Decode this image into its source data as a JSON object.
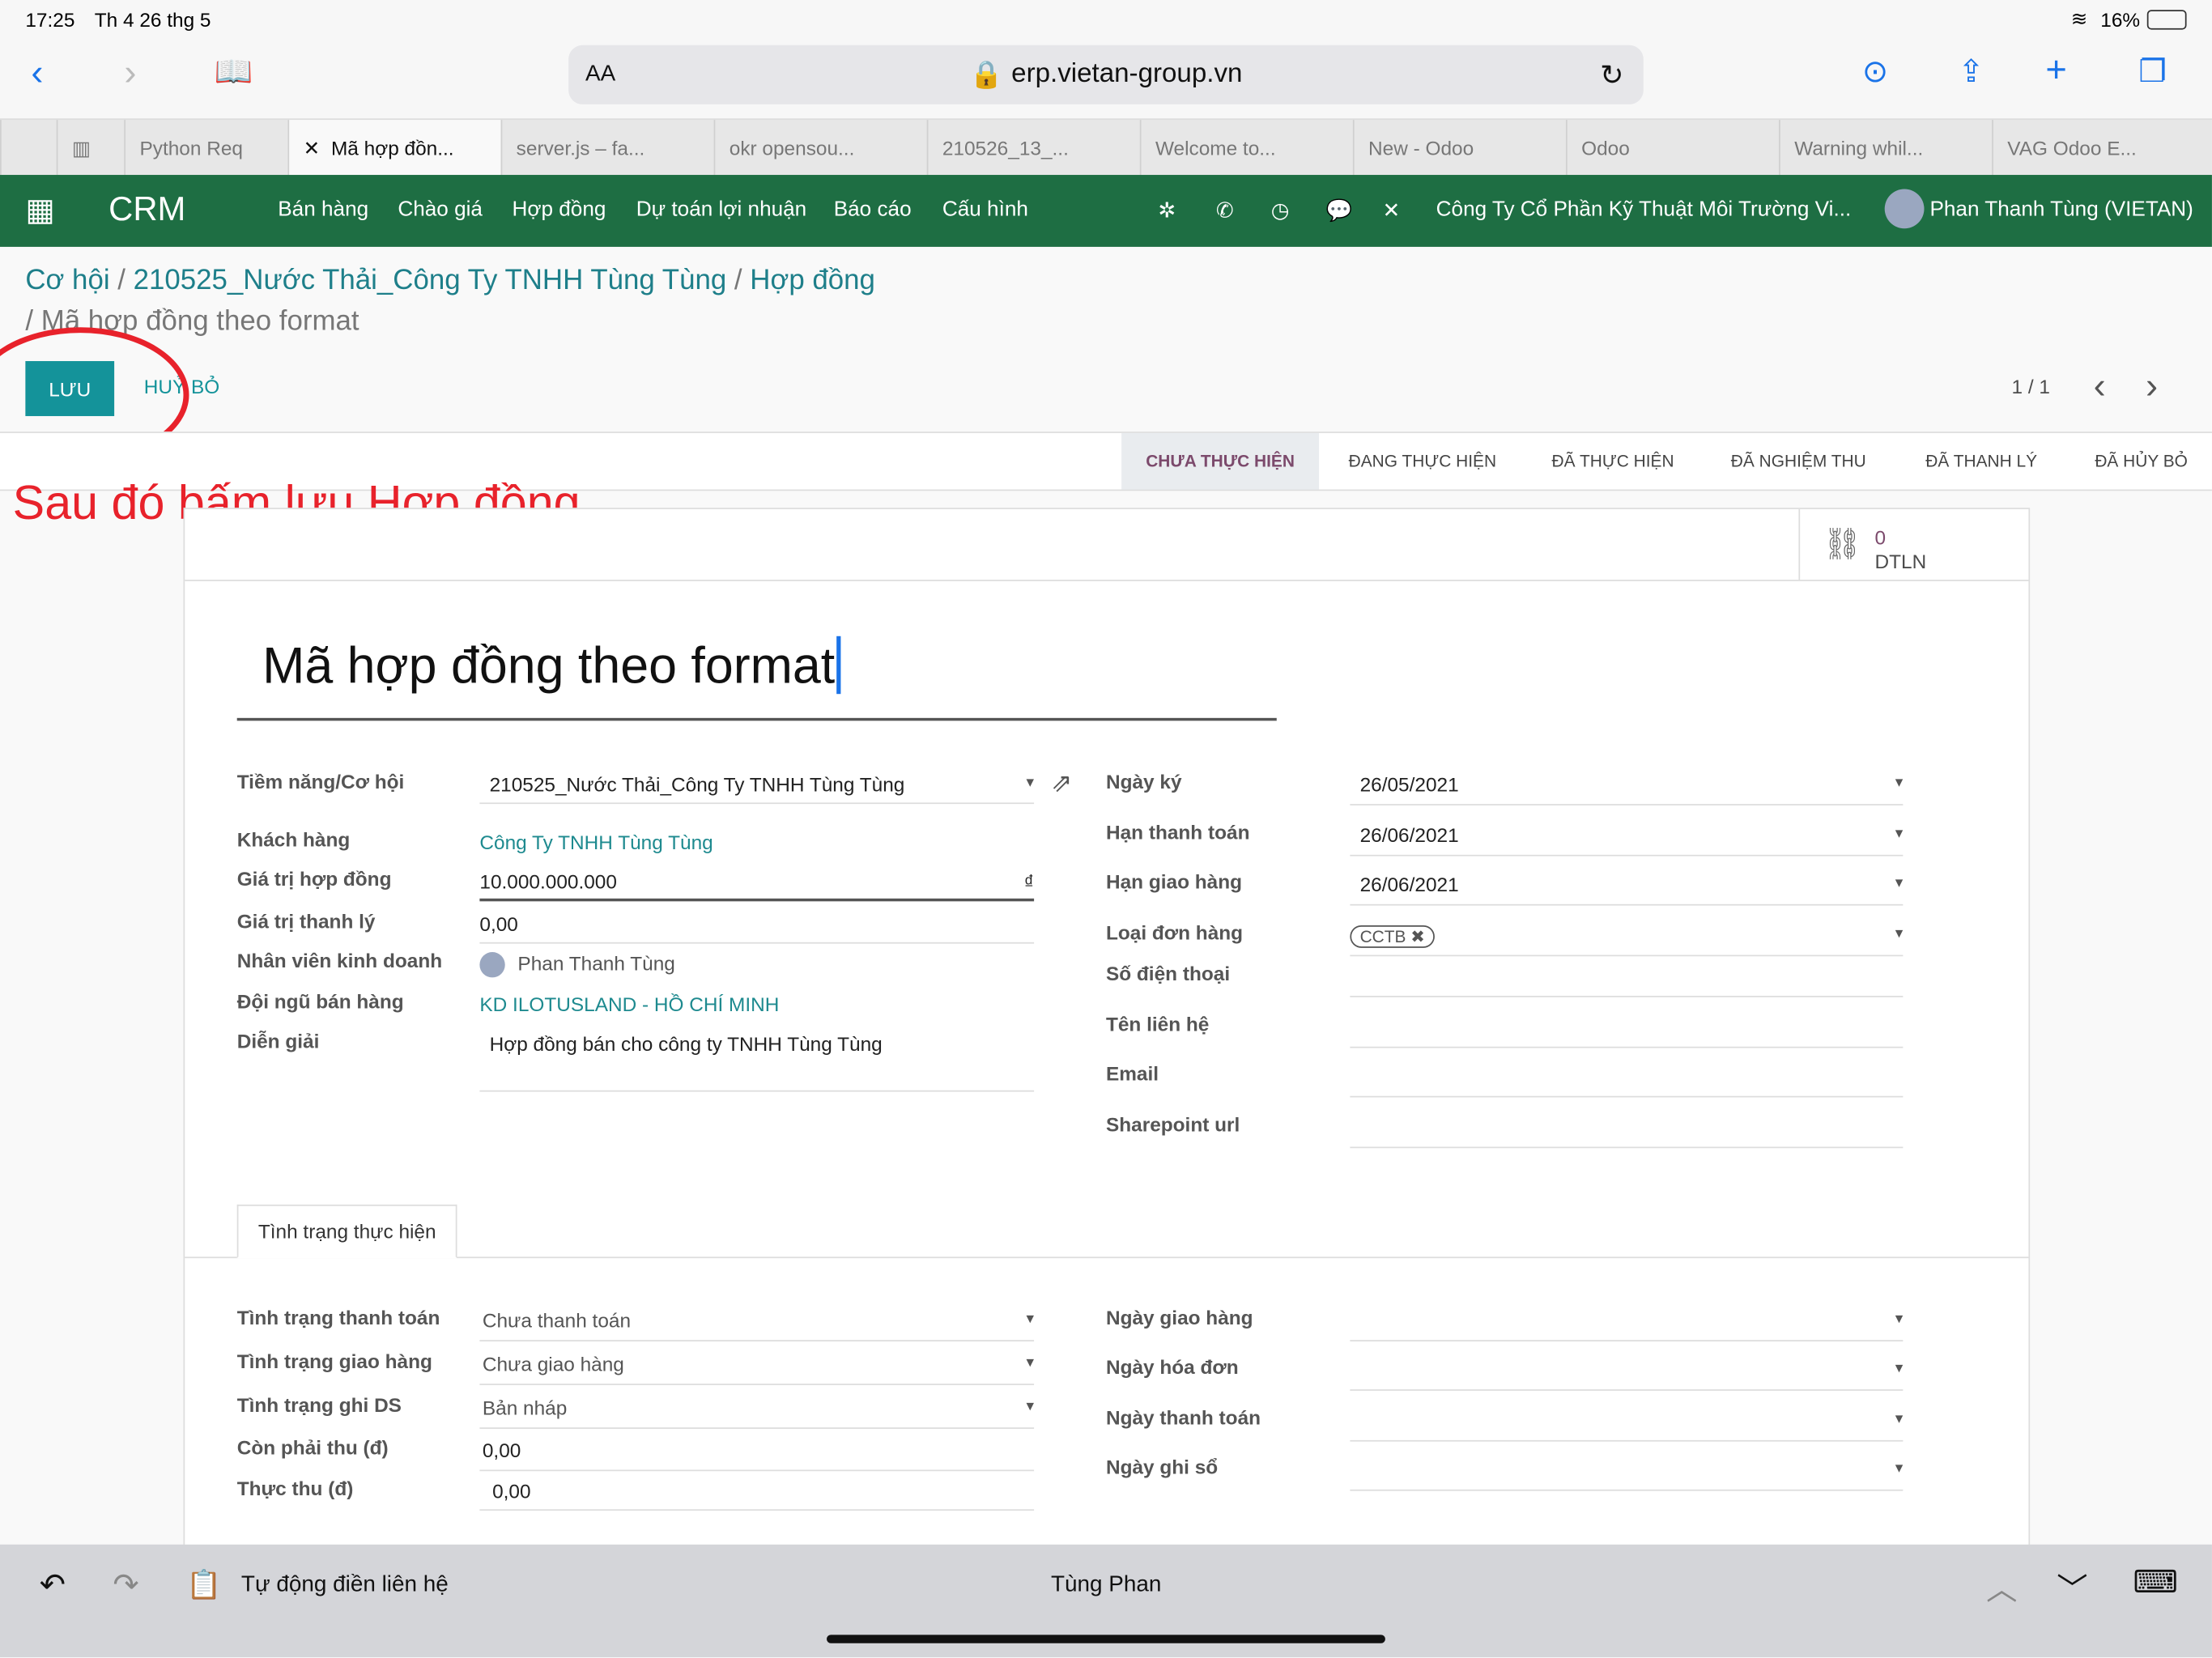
{
  "status": {
    "time": "17:25",
    "date": "Th 4 26 thg 5",
    "battery": "16%"
  },
  "browser": {
    "aa": "AA",
    "url": "erp.vietan-group.vn",
    "tabs": [
      "Python Req",
      "Mã hợp đồn...",
      "server.js – fa...",
      "okr opensou...",
      "210526_13_...",
      "Welcome to...",
      "New - Odoo",
      "Odoo",
      "Warning whil...",
      "VAG Odoo E..."
    ]
  },
  "nav": {
    "app": "CRM",
    "menu": [
      "Bán hàng",
      "Chào giá",
      "Hợp đồng",
      "Dự toán lợi nhuận",
      "Báo cáo",
      "Cấu hình"
    ],
    "company": "Công Ty Cổ Phần Kỹ Thuật Môi Trường Vi...",
    "user": "Phan Thanh Tùng (VIETAN)",
    "color": "#1e6e43"
  },
  "breadcrumb": {
    "items": [
      "Cơ hội",
      "210525_Nước Thải_Công Ty TNHH Tùng Tùng",
      "Hợp đồng"
    ],
    "current": "/ Mã hợp đồng theo format"
  },
  "actions": {
    "save": "LƯU",
    "discard": "HUỶ BỎ",
    "pager": "1 / 1"
  },
  "annotation": "Sau đó bấm lưu Hợp đồng",
  "stages": [
    "CHƯA THỰC HIỆN",
    "ĐANG THỰC HIỆN",
    "ĐÃ THỰC HIỆN",
    "ĐÃ NGHIỆM THU",
    "ĐÃ THANH LÝ",
    "ĐÃ HỦY BỎ"
  ],
  "smart": {
    "count": "0",
    "label": "DTLN"
  },
  "form": {
    "title": "Mã hợp đồng theo format",
    "left": [
      {
        "label": "Tiềm năng/Cơ hội",
        "value": "210525_Nước Thải_Công Ty TNHH Tùng Tùng"
      },
      {
        "label": "Khách hàng",
        "value": "Công Ty TNHH Tùng Tùng"
      },
      {
        "label": "Giá trị hợp đồng",
        "value": "10.000.000.000",
        "unit": "₫"
      },
      {
        "label": "Giá trị thanh lý",
        "value": "0,00"
      },
      {
        "label": "Nhân viên kinh doanh",
        "value": "Phan Thanh Tùng"
      },
      {
        "label": "Đội ngũ bán hàng",
        "value": "KD ILOTUSLAND - HỒ CHÍ MINH"
      },
      {
        "label": "Diễn giải",
        "value": "Hợp đồng bán cho công ty TNHH Tùng Tùng"
      }
    ],
    "right": [
      {
        "label": "Ngày ký",
        "value": "26/05/2021"
      },
      {
        "label": "Hạn thanh toán",
        "value": "26/06/2021"
      },
      {
        "label": "Hạn giao hàng",
        "value": "26/06/2021"
      },
      {
        "label": "Loại đơn hàng",
        "value": "CCTB"
      },
      {
        "label": "Số điện thoại",
        "value": ""
      },
      {
        "label": "Tên liên hệ",
        "value": ""
      },
      {
        "label": "Email",
        "value": ""
      },
      {
        "label": "Sharepoint url",
        "value": ""
      }
    ],
    "tab": "Tình trạng thực hiện",
    "bottom_left": [
      {
        "label": "Tình trạng thanh toán",
        "value": "Chưa thanh toán"
      },
      {
        "label": "Tình trạng giao hàng",
        "value": "Chưa giao hàng"
      },
      {
        "label": "Tình trạng ghi DS",
        "value": "Bản nháp"
      },
      {
        "label": "Còn phải thu (đ)",
        "value": "0,00"
      },
      {
        "label": "Thực thu (đ)",
        "value": "0,00"
      }
    ],
    "bottom_right": [
      {
        "label": "Ngày giao hàng",
        "value": ""
      },
      {
        "label": "Ngày hóa đơn",
        "value": ""
      },
      {
        "label": "Ngày thanh toán",
        "value": ""
      },
      {
        "label": "Ngày ghi sổ",
        "value": ""
      }
    ]
  },
  "keyboard": {
    "autofill": "Tự động điền liên hệ",
    "suggestion": "Tùng Phan"
  }
}
